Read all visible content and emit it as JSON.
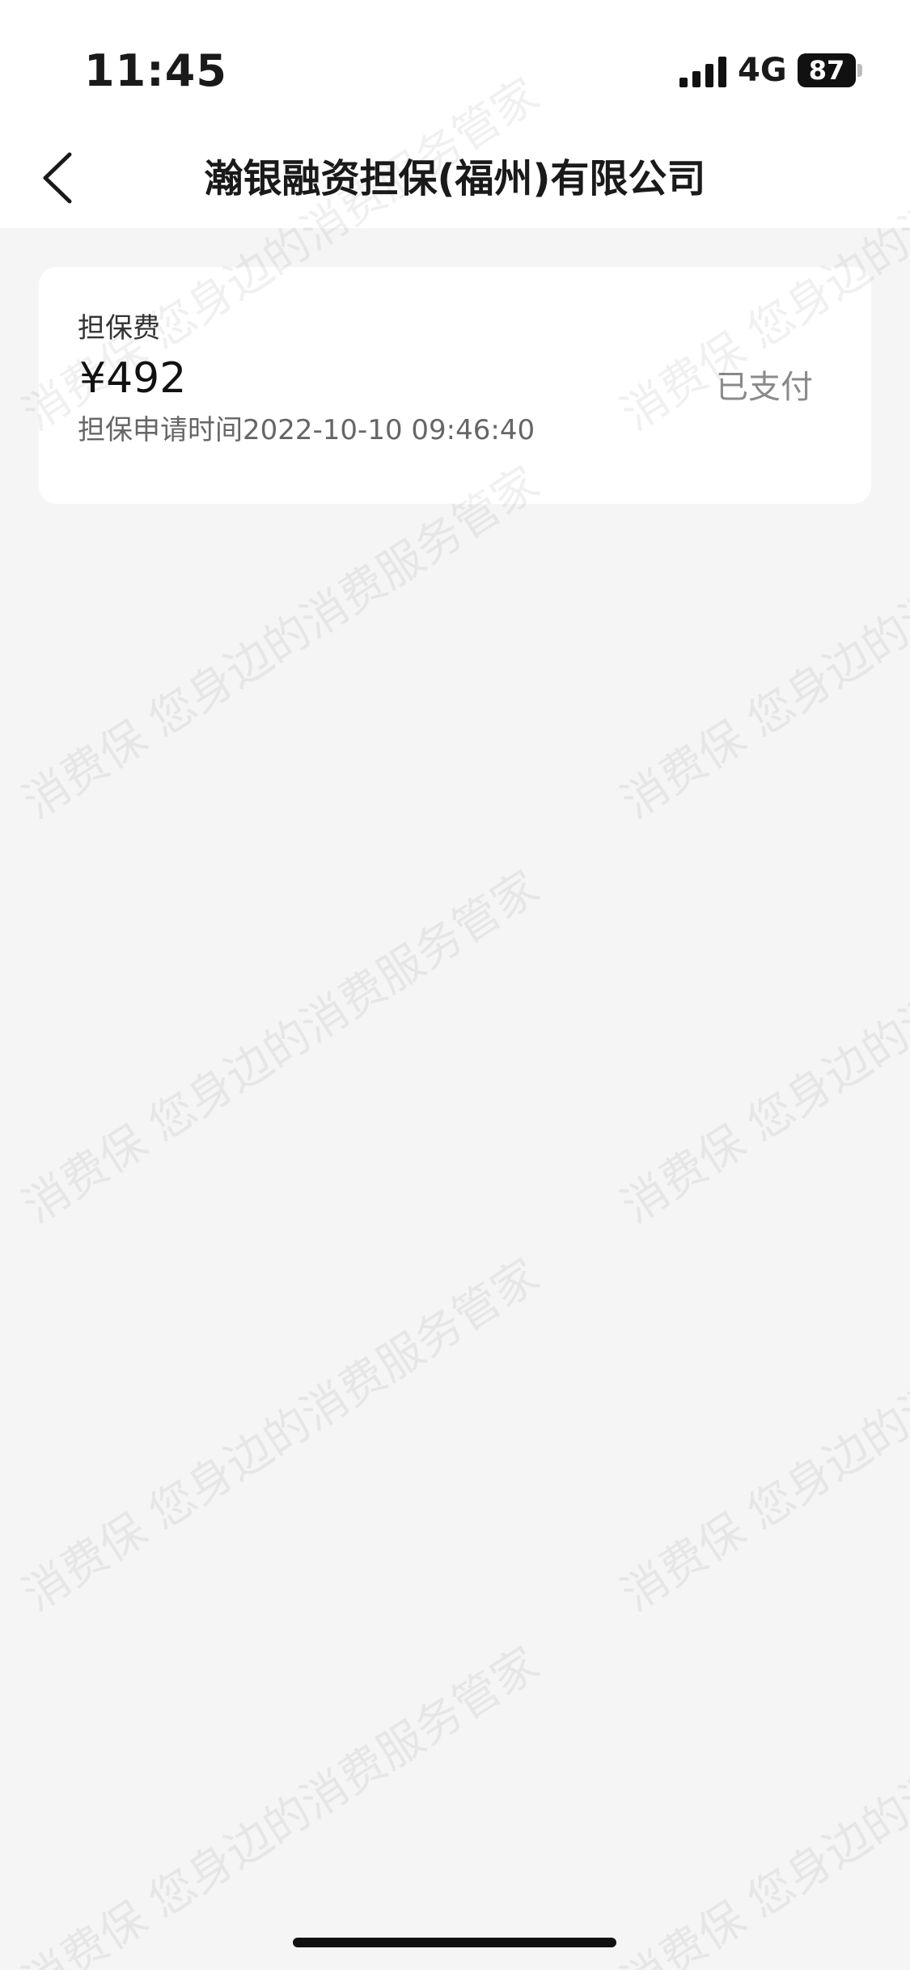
{
  "status_bar": {
    "time": "11:45",
    "network": "4G",
    "battery": "87"
  },
  "nav": {
    "title": "瀚银融资担保(福州)有限公司",
    "back_icon": "chevron-left-icon"
  },
  "fee_card": {
    "label": "担保费",
    "amount": "¥492",
    "time": "担保申请时间2022-10-10 09:46:40",
    "status": "已支付"
  },
  "watermark": {
    "text": "消费保 您身边的消费服务管家"
  }
}
